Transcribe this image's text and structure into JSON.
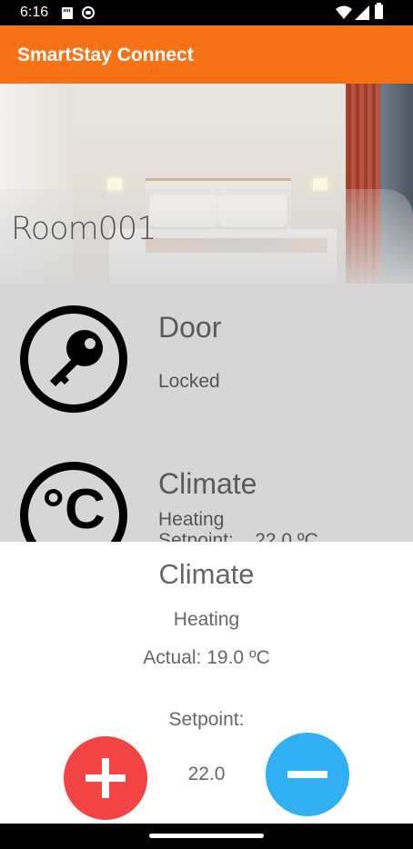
{
  "status_bar": {
    "time": "6:16",
    "icons": [
      "sd-card-icon",
      "circle-status-icon",
      "wifi-icon",
      "signal-icon",
      "battery-icon"
    ]
  },
  "app_bar": {
    "title": "SmartStay Connect",
    "color": "#F57316"
  },
  "room": {
    "name": "Room001"
  },
  "devices": [
    {
      "title": "Door",
      "status": "Locked",
      "icon": "key-icon"
    },
    {
      "title": "Climate",
      "status": "Heating",
      "sub": "Setpoint:    22.0 ºC",
      "icon": "celsius-icon",
      "icon_text": "°C"
    }
  ],
  "climate_sheet": {
    "title": "Climate",
    "mode": "Heating",
    "actual": "Actual: 19.0 ºC",
    "setpoint_label": "Setpoint:",
    "setpoint_value": "22.0",
    "increase_color": "#F44343",
    "decrease_color": "#2FB0F2"
  }
}
